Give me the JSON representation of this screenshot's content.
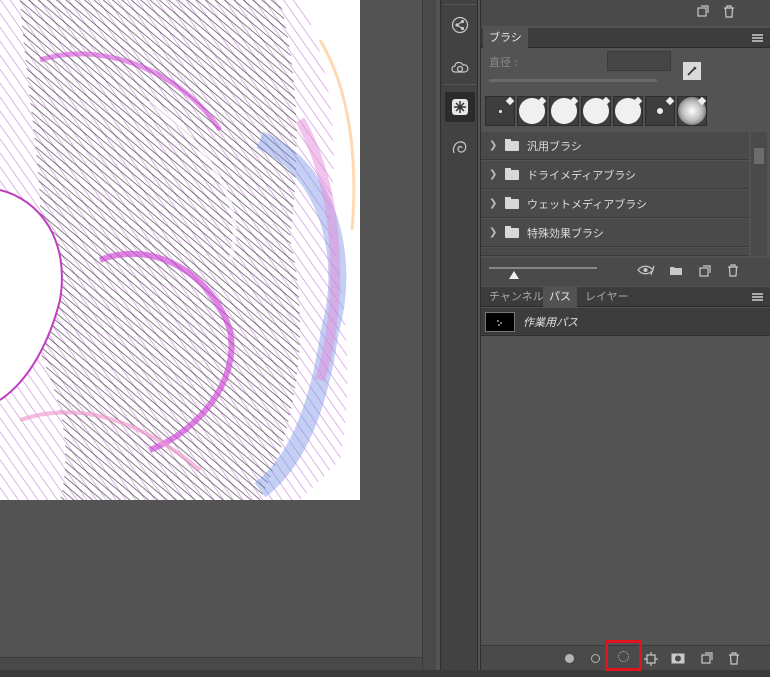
{
  "brush_panel": {
    "tab_label": "ブラシ",
    "size_label": "直径 :",
    "size_value": "",
    "tips": [
      "dot-small",
      "round-hard",
      "round-hard",
      "round-hard",
      "round-hard",
      "dot-tiny",
      "soft-round"
    ],
    "folders": [
      {
        "label": "汎用ブラシ"
      },
      {
        "label": "ドライメディアブラシ"
      },
      {
        "label": "ウェットメディアブラシ"
      },
      {
        "label": "特殊効果ブラシ"
      }
    ]
  },
  "paths_panel": {
    "tabs": [
      {
        "label": "チャンネル"
      },
      {
        "label": "パス"
      },
      {
        "label": "レイヤー"
      }
    ],
    "active_tab": "パス",
    "paths": [
      {
        "name": "作業用パス"
      }
    ]
  },
  "dock_icons": [
    "share-icon",
    "creative-cloud-icon",
    "brush-settings-icon",
    "clone-source-icon"
  ],
  "colors": {
    "highlight": "#e0141e",
    "panel_bg": "#535353",
    "artwork_magenta": "#d24fd8",
    "artwork_blue": "#6f8fe0"
  }
}
